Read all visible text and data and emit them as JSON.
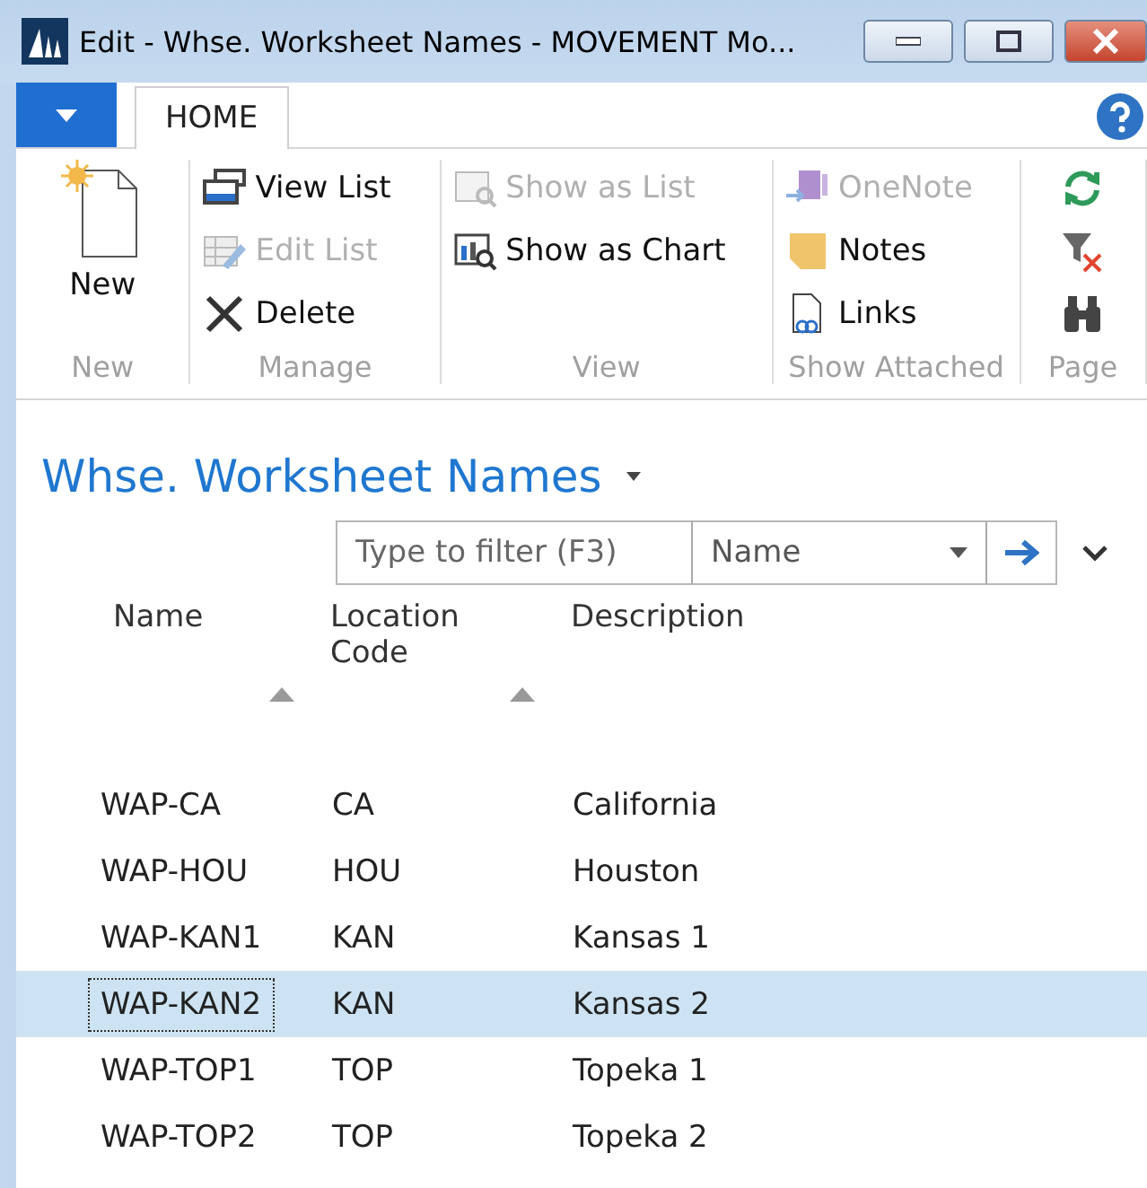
{
  "window": {
    "title": "Edit - Whse. Worksheet Names - MOVEMENT Mo..."
  },
  "ribbon": {
    "tabs": [
      {
        "label": "HOME",
        "selected": true
      }
    ],
    "groups": [
      {
        "label": "New",
        "kind": "large",
        "items": [
          {
            "label": "New",
            "disabled": false
          }
        ]
      },
      {
        "label": "Manage",
        "kind": "list",
        "items": [
          {
            "label": "View List",
            "disabled": false
          },
          {
            "label": "Edit List",
            "disabled": true
          },
          {
            "label": "Delete",
            "disabled": false
          }
        ]
      },
      {
        "label": "View",
        "kind": "list",
        "items": [
          {
            "label": "Show as List",
            "disabled": true
          },
          {
            "label": "Show as Chart",
            "disabled": false
          }
        ]
      },
      {
        "label": "Show Attached",
        "kind": "list",
        "items": [
          {
            "label": "OneNote",
            "disabled": true
          },
          {
            "label": "Notes",
            "disabled": false
          },
          {
            "label": "Links",
            "disabled": false
          }
        ]
      },
      {
        "label": "Page",
        "kind": "icons",
        "items": [
          {
            "disabled": false
          },
          {
            "disabled": false
          },
          {
            "disabled": false
          }
        ]
      }
    ]
  },
  "page_title": "Whse. Worksheet Names",
  "filter": {
    "placeholder": "Type to filter (F3)",
    "field": "Name"
  },
  "table": {
    "columns": [
      {
        "label": "Name",
        "sorted": true
      },
      {
        "label": "Location Code",
        "sorted": true
      },
      {
        "label": "Description",
        "sorted": false
      }
    ],
    "rows": [
      {
        "cells": [
          "WAP-CA",
          "CA",
          "California"
        ],
        "selected": false
      },
      {
        "cells": [
          "WAP-HOU",
          "HOU",
          "Houston"
        ],
        "selected": false
      },
      {
        "cells": [
          "WAP-KAN1",
          "KAN",
          "Kansas 1"
        ],
        "selected": false
      },
      {
        "cells": [
          "WAP-KAN2",
          "KAN",
          "Kansas 2"
        ],
        "selected": true
      },
      {
        "cells": [
          "WAP-TOP1",
          "TOP",
          "Topeka 1"
        ],
        "selected": false
      },
      {
        "cells": [
          "WAP-TOP2",
          "TOP",
          "Topeka 2"
        ],
        "selected": false
      }
    ]
  }
}
